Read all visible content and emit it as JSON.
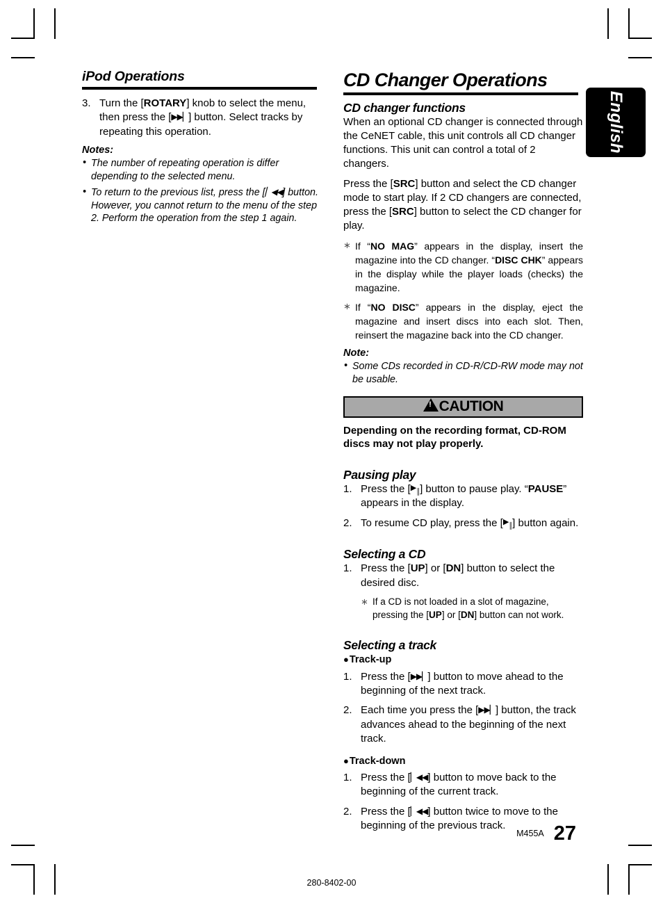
{
  "page": {
    "number": "27",
    "model_code": "M455A",
    "doc_code": "280-8402-00",
    "language_tab": "English"
  },
  "left_column": {
    "heading": "iPod Operations",
    "step_3": {
      "num": "3.",
      "text_a": "Turn the [",
      "rotary": "ROTARY",
      "text_b": "] knob to select the menu, then press the [",
      "text_c": "] button. Select tracks by repeating this operation."
    },
    "notes_label": "Notes:",
    "notes": [
      {
        "bullet": "•",
        "text": "The number of repeating operation is differ depending to the selected menu."
      },
      {
        "bullet": "•",
        "text_a": "To return to the previous list, press the [",
        "text_b": "] button. However, you cannot return to the menu of the step 2. Perform the operation from the step 1 again."
      }
    ]
  },
  "right_column": {
    "heading": "CD Changer Operations",
    "cd_changer_functions": {
      "title": "CD changer functions",
      "paragraph_1": "When an optional CD changer is connected through the CeNET cable, this unit controls all CD changer functions. This unit can control a total of 2 changers.",
      "paragraph_2_a": "Press the [",
      "paragraph_2_src1": "SRC",
      "paragraph_2_b": "] button and select the CD changer mode to start play. If 2 CD changers are connected, press the [",
      "paragraph_2_src2": "SRC",
      "paragraph_2_c": "] button to select the CD changer for play.",
      "note_no_mag": {
        "asterisk": "∗",
        "text_a": "If “",
        "term_1": "NO MAG",
        "text_b": "” appears in the display, insert the magazine into the CD changer. “",
        "term_2": "DISC CHK",
        "text_c": "” appears in the display while the player loads (checks) the magazine."
      },
      "note_no_disc": {
        "asterisk": "∗",
        "text_a": "If “",
        "term_1": "NO DISC",
        "text_b": "” appears in the display, eject the magazine and insert discs into each slot. Then, reinsert the magazine back into the CD changer."
      },
      "note_label": "Note:",
      "note_bullet": "•",
      "note_text": "Some CDs recorded in CD-R/CD-RW mode may not be usable."
    },
    "caution": {
      "label": "CAUTION",
      "icon": "warning-triangle",
      "body": "Depending on the recording format, CD-ROM discs may not play properly.",
      "background_color": "#a8a8a8",
      "border_color": "#000000"
    },
    "pausing_play": {
      "title": "Pausing play",
      "steps": [
        {
          "num": "1.",
          "text_a": "Press the [",
          "text_b": "] button to pause play. “",
          "term": "PAUSE",
          "text_c": "” appears in the display."
        },
        {
          "num": "2.",
          "text_a": "To resume CD play, press the [",
          "text_b": "] button again."
        }
      ]
    },
    "selecting_a_cd": {
      "title": "Selecting a CD",
      "step_1": {
        "num": "1.",
        "text_a": "Press the [",
        "up": "UP",
        "text_b": "] or [",
        "dn": "DN",
        "text_c": "] button to select the desired disc."
      },
      "note": {
        "asterisk": "∗",
        "text_a": "If a CD is not loaded in a slot of magazine, pressing the [",
        "up": "UP",
        "text_b": "] or [",
        "dn": "DN",
        "text_c": "] button can not work."
      }
    },
    "selecting_a_track": {
      "title": "Selecting a track",
      "track_up": {
        "dot": "●",
        "label": "Track-up",
        "steps": [
          {
            "num": "1.",
            "text_a": "Press the [",
            "text_b": "] button to move ahead to the beginning of the next track."
          },
          {
            "num": "2.",
            "text_a": "Each time you press the [",
            "text_b": "] button, the track advances ahead to the beginning of the next track."
          }
        ]
      },
      "track_down": {
        "dot": "●",
        "label": "Track-down",
        "steps": [
          {
            "num": "1.",
            "text_a": "Press the [",
            "text_b": "] button to move back to the beginning of the current track."
          },
          {
            "num": "2.",
            "text_a": "Press the [",
            "text_b": "] button twice to move to the beginning of the previous track."
          }
        ]
      }
    }
  }
}
